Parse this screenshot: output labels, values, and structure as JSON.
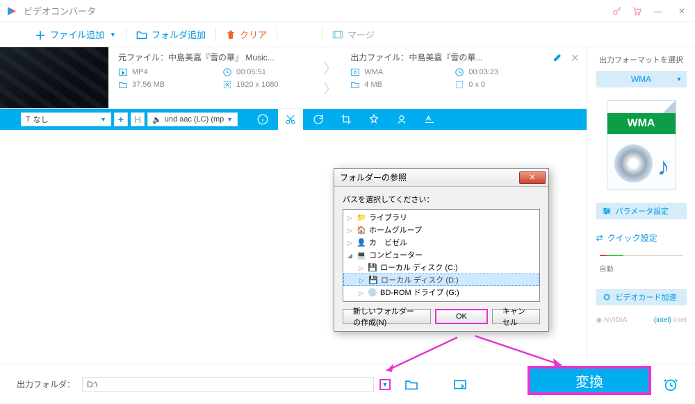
{
  "app": {
    "title": "ビデオコンバータ"
  },
  "toolbar": {
    "add_file": "ファイル追加",
    "add_folder": "フォルダ追加",
    "clear": "クリア",
    "merge": "マージ"
  },
  "item": {
    "src": {
      "label": "元ファイル：",
      "name": "中島美嘉『雪の華』 Music...",
      "format": "MP4",
      "duration": "00:05:51",
      "size": "37.56 MB",
      "resolution": "1920 x 1080"
    },
    "dst": {
      "label": "出力ファイル：",
      "name": "中島美嘉『雪の華...",
      "format": "WMA",
      "duration": "00:03:23",
      "size": "4 MB",
      "resolution": "0 x 0"
    }
  },
  "editbar": {
    "subtitle": "なし",
    "audio": "und aac (LC) (mp"
  },
  "side": {
    "select_format": "出力フォーマットを選択",
    "format": "WMA",
    "format_band": "WMA",
    "params": "パラメータ設定",
    "quick": "クイック設定",
    "auto": "自動",
    "gpu": "ビデオカード加速",
    "nvidia": "NVIDIA",
    "intel": "Intel"
  },
  "footer": {
    "label": "出力フォルダ：",
    "path": "D:\\",
    "convert": "変換"
  },
  "dialog": {
    "title": "フォルダーの参照",
    "prompt": "パスを選択してください：",
    "items": [
      "ライブラリ",
      "ホームグループ",
      "カ　ビゼル",
      "コンピューター",
      "ローカル ディスク (C:)",
      "ローカル ディスク (D:)",
      "BD-ROM ドライブ (G:)"
    ],
    "new_folder": "新しいフォルダーの作成(N)",
    "ok": "OK",
    "cancel": "キャンセル"
  }
}
